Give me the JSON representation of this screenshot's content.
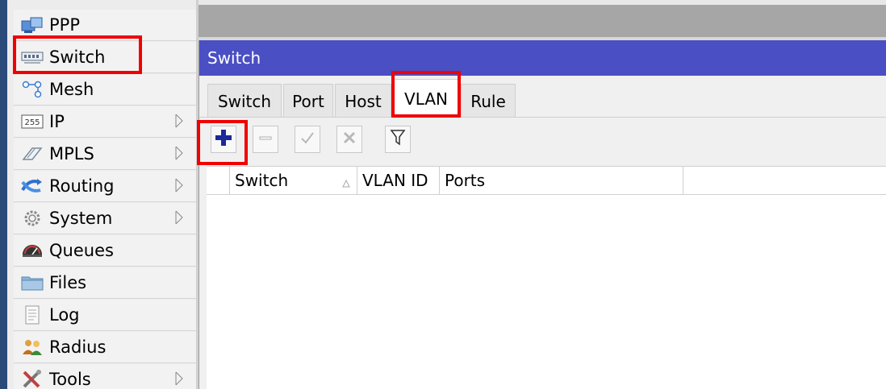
{
  "sidebar": {
    "items": [
      {
        "label": "PPP",
        "icon": "ppp-icon",
        "submenu": false
      },
      {
        "label": "Switch",
        "icon": "switch-icon",
        "submenu": false
      },
      {
        "label": "Mesh",
        "icon": "mesh-icon",
        "submenu": false
      },
      {
        "label": "IP",
        "icon": "ip-icon",
        "icon_text": "255",
        "submenu": true
      },
      {
        "label": "MPLS",
        "icon": "mpls-icon",
        "submenu": true
      },
      {
        "label": "Routing",
        "icon": "routing-icon",
        "submenu": true
      },
      {
        "label": "System",
        "icon": "system-gear-icon",
        "submenu": true
      },
      {
        "label": "Queues",
        "icon": "queues-icon",
        "submenu": false
      },
      {
        "label": "Files",
        "icon": "folder-icon",
        "submenu": false
      },
      {
        "label": "Log",
        "icon": "log-icon",
        "submenu": false
      },
      {
        "label": "Radius",
        "icon": "radius-users-icon",
        "submenu": false
      },
      {
        "label": "Tools",
        "icon": "tools-icon",
        "submenu": true
      }
    ]
  },
  "window": {
    "title": "Switch",
    "tabs": [
      {
        "label": "Switch",
        "active": false
      },
      {
        "label": "Port",
        "active": false
      },
      {
        "label": "Host",
        "active": false
      },
      {
        "label": "VLAN",
        "active": true
      },
      {
        "label": "Rule",
        "active": false
      }
    ],
    "toolbar": [
      "add-icon",
      "remove-icon",
      "enable-check-icon",
      "disable-x-icon",
      "filter-icon"
    ],
    "table": {
      "columns": [
        "Switch",
        "VLAN ID",
        "Ports"
      ],
      "rows": []
    }
  },
  "colors": {
    "title_bar": "#4a4fc4",
    "highlight": "#f00000",
    "add_icon": "#1a2a9a"
  }
}
